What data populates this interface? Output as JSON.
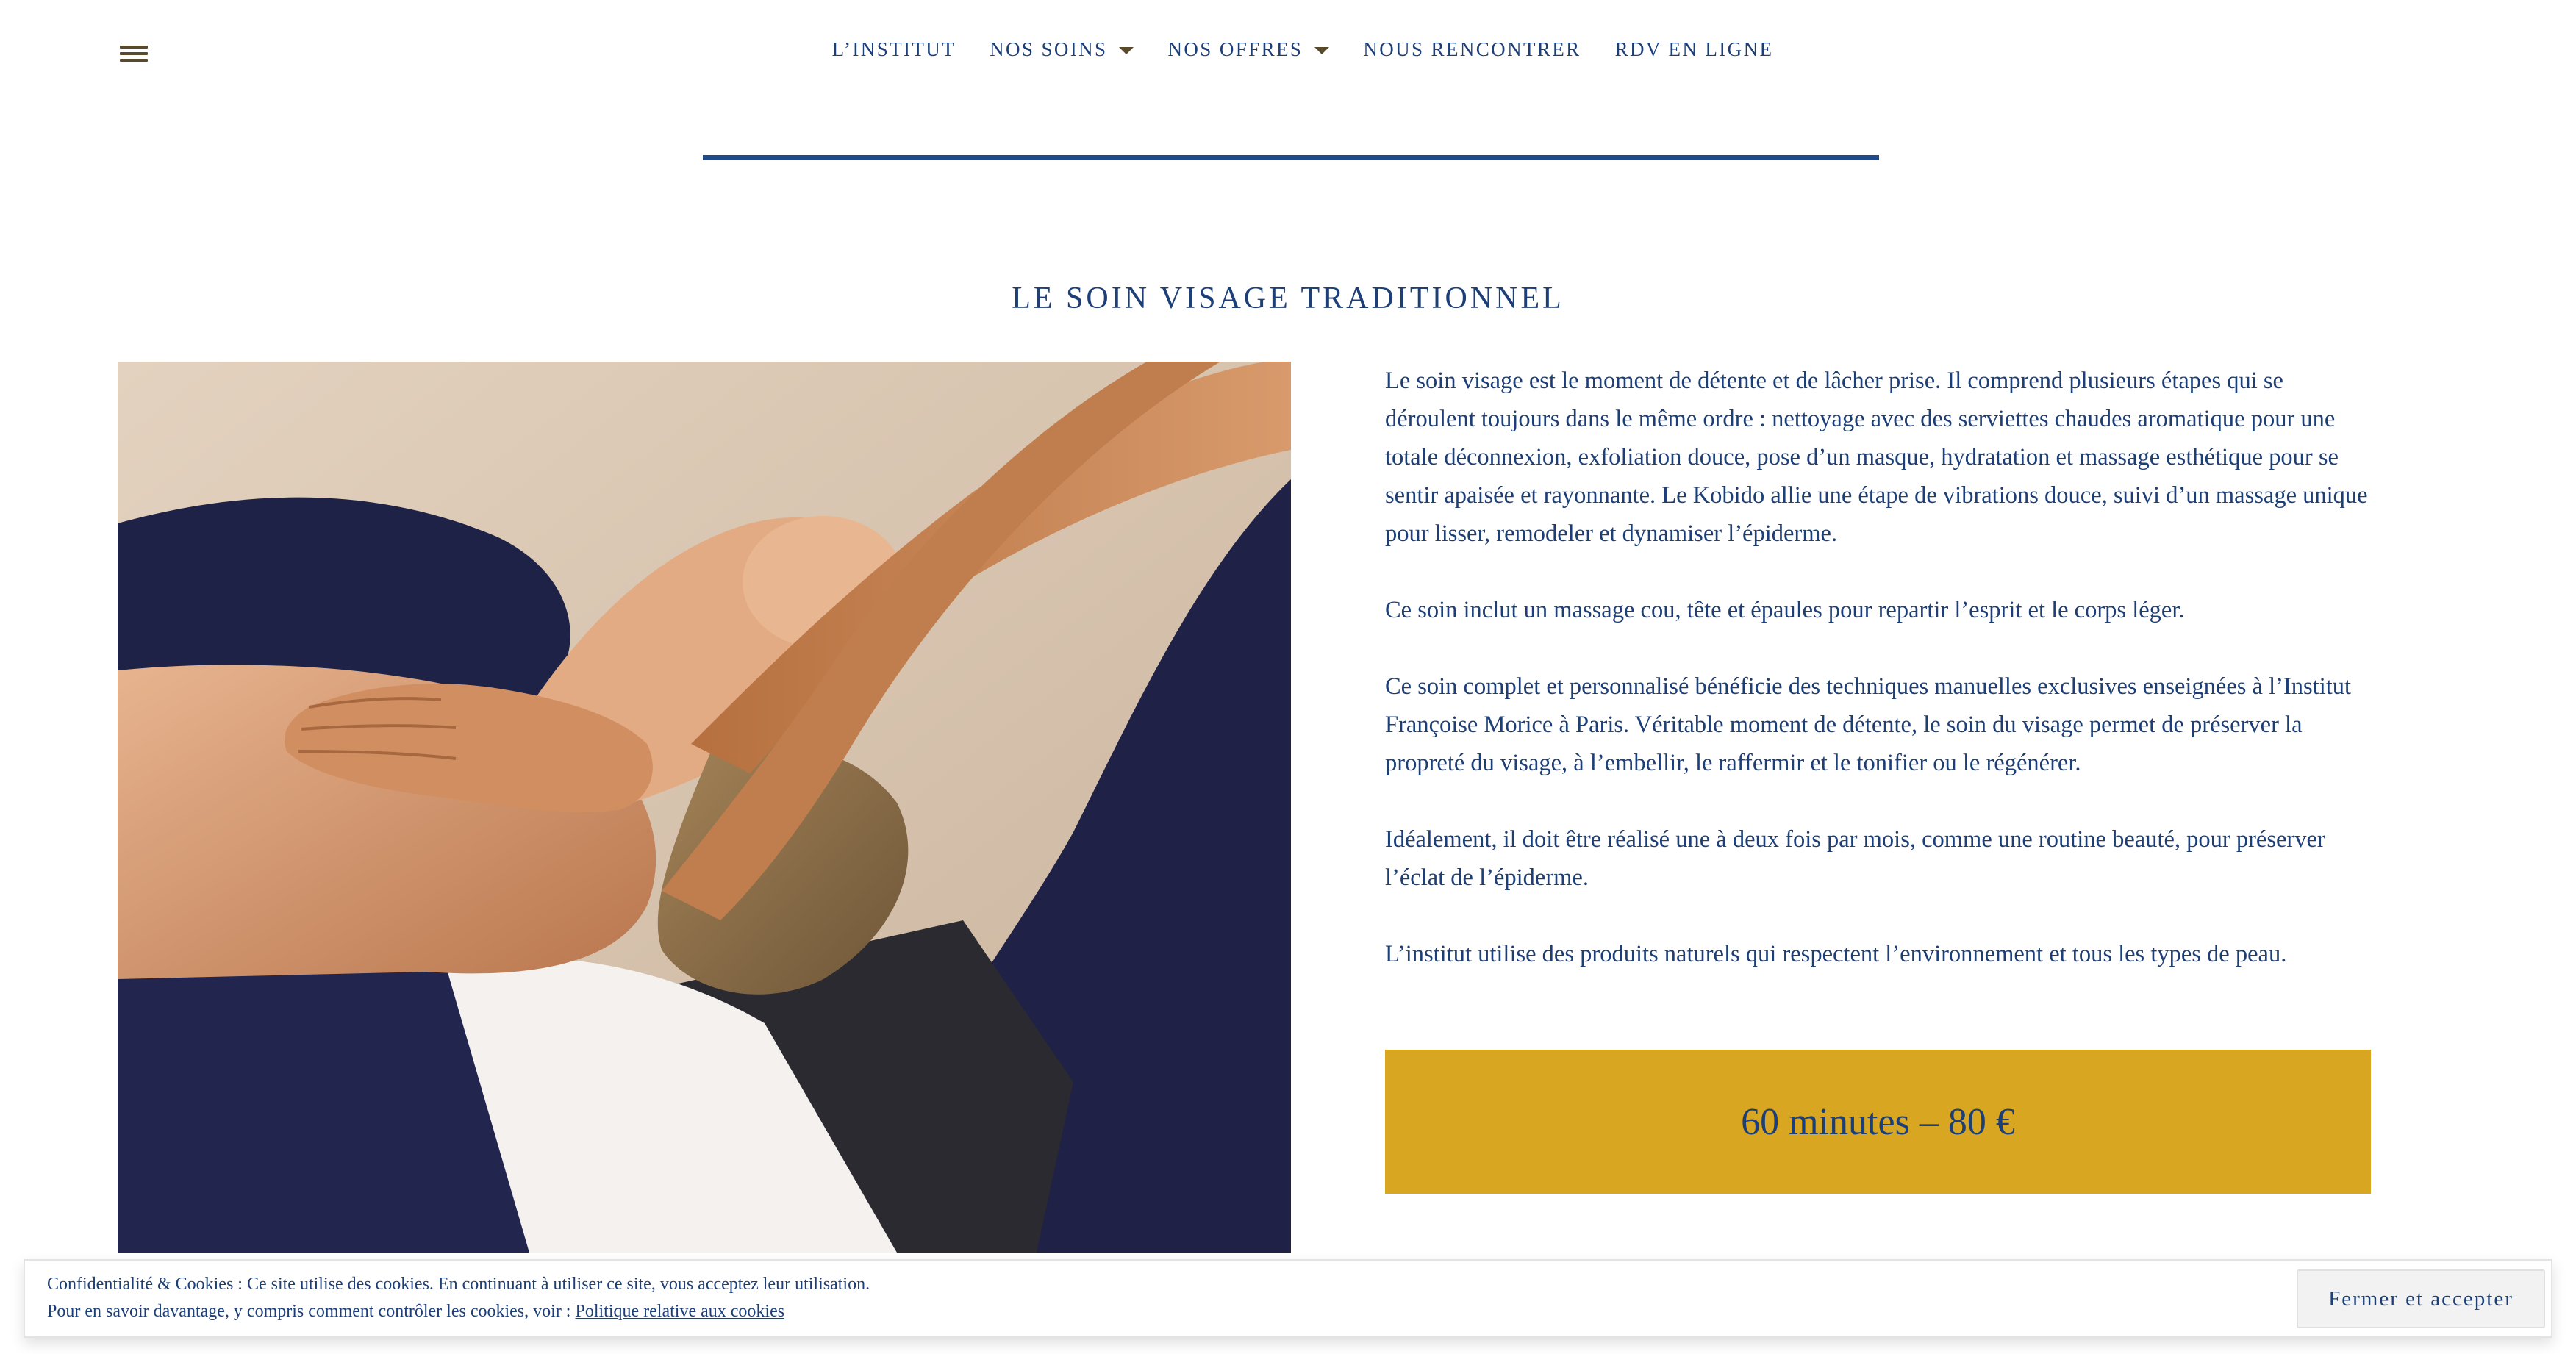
{
  "header": {
    "menu_icon": "hamburger-menu-icon",
    "nav": [
      {
        "label": "L’INSTITUT",
        "has_dropdown": false
      },
      {
        "label": "NOS SOINS",
        "has_dropdown": true
      },
      {
        "label": "NOS OFFRES",
        "has_dropdown": true
      },
      {
        "label": "NOUS RENCONTRER",
        "has_dropdown": false
      },
      {
        "label": "RDV EN LIGNE",
        "has_dropdown": false
      }
    ],
    "dropdown_icon": "caret-down-icon"
  },
  "main": {
    "title": "LE SOIN VISAGE TRADITIONNEL",
    "paragraphs": [
      "Le soin visage est le moment de détente et de lâcher prise. Il comprend plusieurs étapes qui se déroulent toujours dans le même ordre : nettoyage avec des serviettes chaudes aromatique pour une totale déconnexion, exfoliation douce, pose d’un masque, hydratation et massage esthétique pour se sentir apaisée et rayonnante. Le Kobido allie une étape de vibrations douce, suivi d’un massage unique pour lisser, remodeler et dynamiser l’épiderme.",
      "Ce soin inclut un massage cou, tête et épaules pour repartir l’esprit et le corps léger.",
      "Ce soin complet et personnalisé bénéficie des techniques manuelles exclusives enseignées à l’Institut Françoise Morice à Paris. Véritable moment de détente, le soin du visage permet de préserver la propreté du visage, à l’embellir, le raffermir et le tonifier ou le régénérer.",
      "Idéalement, il doit être réalisé une à deux fois par mois, comme une routine beauté, pour préserver l’éclat de l’épiderme.",
      "L’institut utilise des produits naturels qui respectent l’environnement et tous les types de peau."
    ],
    "price": "60 minutes – 80 €"
  },
  "cookie_banner": {
    "line1": "Confidentialité & Cookies : Ce site utilise des cookies. En continuant à utiliser ce site, vous acceptez leur utilisation.",
    "line2_prefix": "Pour en savoir davantage, y compris comment contrôler les cookies, voir : ",
    "link_label": "Politique relative aux cookies",
    "button_label": "Fermer et accepter"
  },
  "colors": {
    "text": "#1d3f78",
    "rule": "#1f4a8c",
    "price_box": "#d8a620",
    "icon": "#5a4a2c"
  }
}
